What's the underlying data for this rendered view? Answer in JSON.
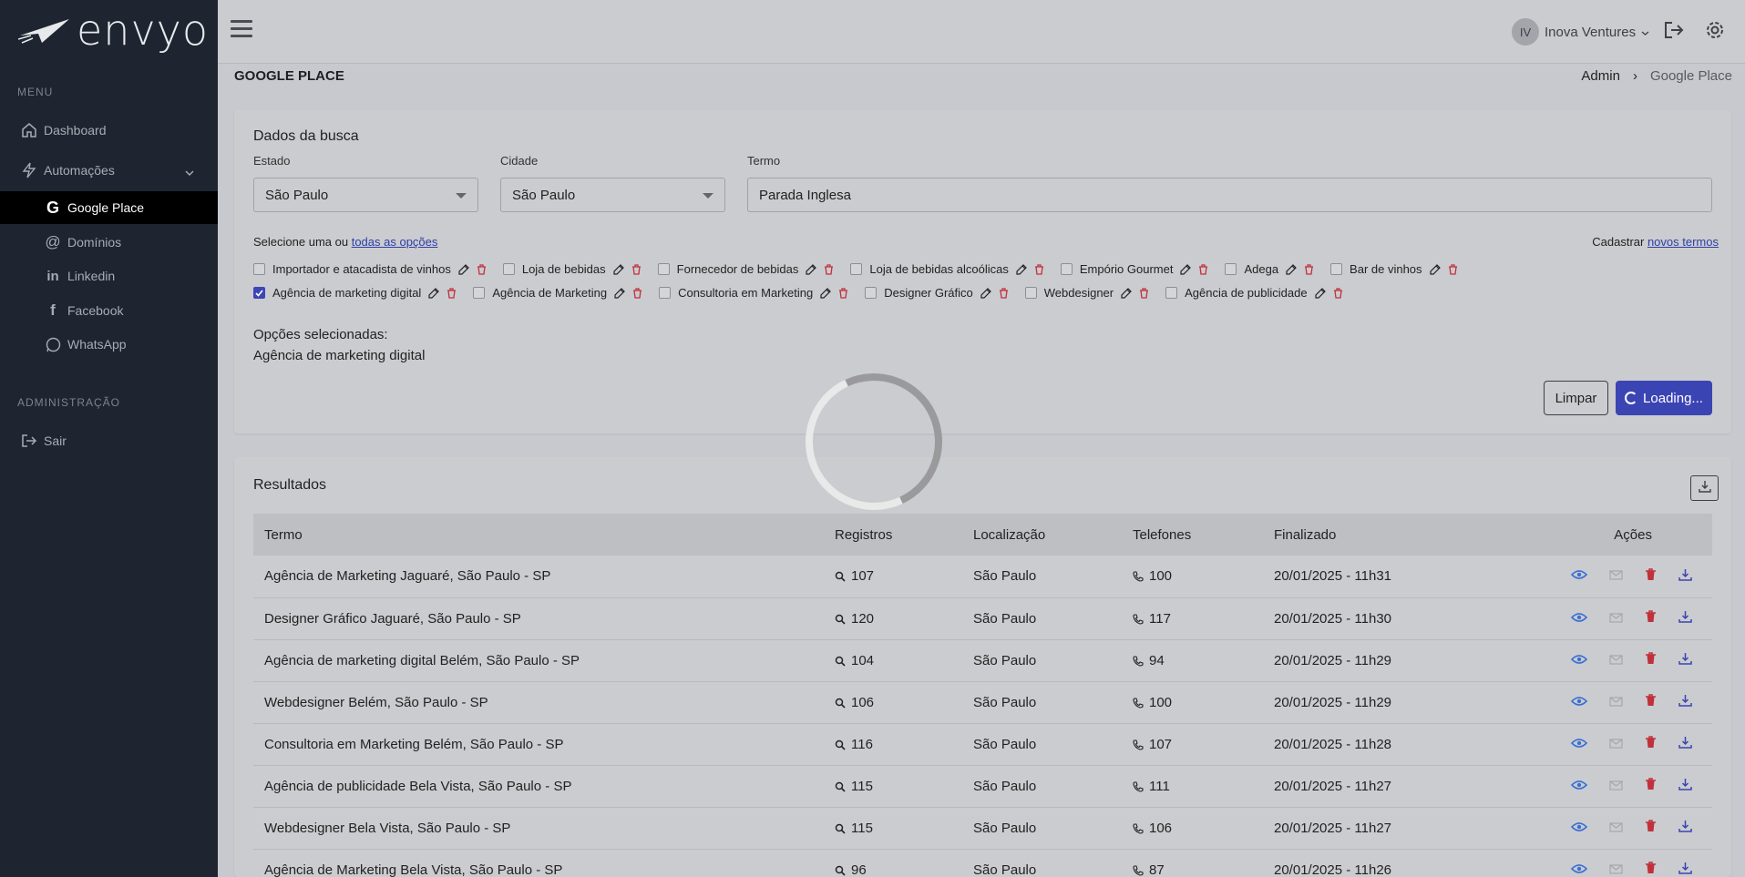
{
  "app": {
    "logo_text": "envyo"
  },
  "sidebar": {
    "menu_title": "MENU",
    "items": [
      {
        "label": "Dashboard",
        "icon": "home-icon"
      },
      {
        "label": "Automações",
        "icon": "bolt-icon"
      },
      {
        "label": "Google Place",
        "icon": "google-icon"
      },
      {
        "label": "Domínios",
        "icon": "at-icon"
      },
      {
        "label": "Linkedin",
        "icon": "linkedin-icon"
      },
      {
        "label": "Facebook",
        "icon": "facebook-icon"
      },
      {
        "label": "WhatsApp",
        "icon": "whatsapp-icon"
      }
    ],
    "admin_title": "ADMINISTRAÇÃO",
    "sair_label": "Sair"
  },
  "topbar": {
    "avatar_initials": "IV",
    "user_name": "Inova Ventures"
  },
  "page": {
    "title": "GOOGLE PLACE",
    "breadcrumb": [
      "Admin",
      "Google Place"
    ]
  },
  "search": {
    "title": "Dados da busca",
    "estado_label": "Estado",
    "estado_value": "São Paulo",
    "cidade_label": "Cidade",
    "cidade_value": "São Paulo",
    "termo_label": "Termo",
    "termo_value": "Parada Inglesa",
    "select_text": "Selecione uma ou",
    "select_link": "todas as opções",
    "register_text": "Cadastrar",
    "register_link": "novos termos",
    "options_row1": [
      {
        "label": "Importador e atacadista de vinhos",
        "checked": false
      },
      {
        "label": "Loja de bebidas",
        "checked": false
      },
      {
        "label": "Fornecedor de bebidas",
        "checked": false
      },
      {
        "label": "Loja de bebidas alcoólicas",
        "checked": false
      },
      {
        "label": "Empório Gourmet",
        "checked": false
      },
      {
        "label": "Adega",
        "checked": false
      },
      {
        "label": "Bar de vinhos",
        "checked": false
      }
    ],
    "options_row2": [
      {
        "label": "Agência de marketing digital",
        "checked": true
      },
      {
        "label": "Agência de Marketing",
        "checked": false
      },
      {
        "label": "Consultoria em Marketing",
        "checked": false
      },
      {
        "label": "Designer Gráfico",
        "checked": false
      },
      {
        "label": "Webdesigner",
        "checked": false
      },
      {
        "label": "Agência de publicidade",
        "checked": false
      }
    ],
    "selected_title": "Opções selecionadas:",
    "selected_value": "Agência de marketing digital",
    "clear_label": "Limpar",
    "loading_label": "Loading..."
  },
  "results": {
    "title": "Resultados",
    "columns": [
      "Termo",
      "Registros",
      "Localização",
      "Telefones",
      "Finalizado",
      "Ações"
    ],
    "rows": [
      {
        "termo": "Agência de Marketing Jaguaré, São Paulo - SP",
        "registros": "107",
        "local": "São Paulo",
        "telefones": "100",
        "finalizado": "20/01/2025 - 11h31"
      },
      {
        "termo": "Designer Gráfico Jaguaré, São Paulo - SP",
        "registros": "120",
        "local": "São Paulo",
        "telefones": "117",
        "finalizado": "20/01/2025 - 11h30"
      },
      {
        "termo": "Agência de marketing digital Belém, São Paulo - SP",
        "registros": "104",
        "local": "São Paulo",
        "telefones": "94",
        "finalizado": "20/01/2025 - 11h29"
      },
      {
        "termo": "Webdesigner Belém, São Paulo - SP",
        "registros": "106",
        "local": "São Paulo",
        "telefones": "100",
        "finalizado": "20/01/2025 - 11h29"
      },
      {
        "termo": "Consultoria em Marketing Belém, São Paulo - SP",
        "registros": "116",
        "local": "São Paulo",
        "telefones": "107",
        "finalizado": "20/01/2025 - 11h28"
      },
      {
        "termo": "Agência de publicidade Bela Vista, São Paulo - SP",
        "registros": "115",
        "local": "São Paulo",
        "telefones": "111",
        "finalizado": "20/01/2025 - 11h27"
      },
      {
        "termo": "Webdesigner Bela Vista, São Paulo - SP",
        "registros": "115",
        "local": "São Paulo",
        "telefones": "106",
        "finalizado": "20/01/2025 - 11h27"
      },
      {
        "termo": "Agência de Marketing Bela Vista, São Paulo - SP",
        "registros": "96",
        "local": "São Paulo",
        "telefones": "87",
        "finalizado": "20/01/2025 - 11h26"
      }
    ]
  },
  "colors": {
    "sidebar_bg": "#1e2530",
    "primary": "#3b44b3",
    "danger": "#c0313c",
    "action_blue": "#3b6fd4"
  }
}
